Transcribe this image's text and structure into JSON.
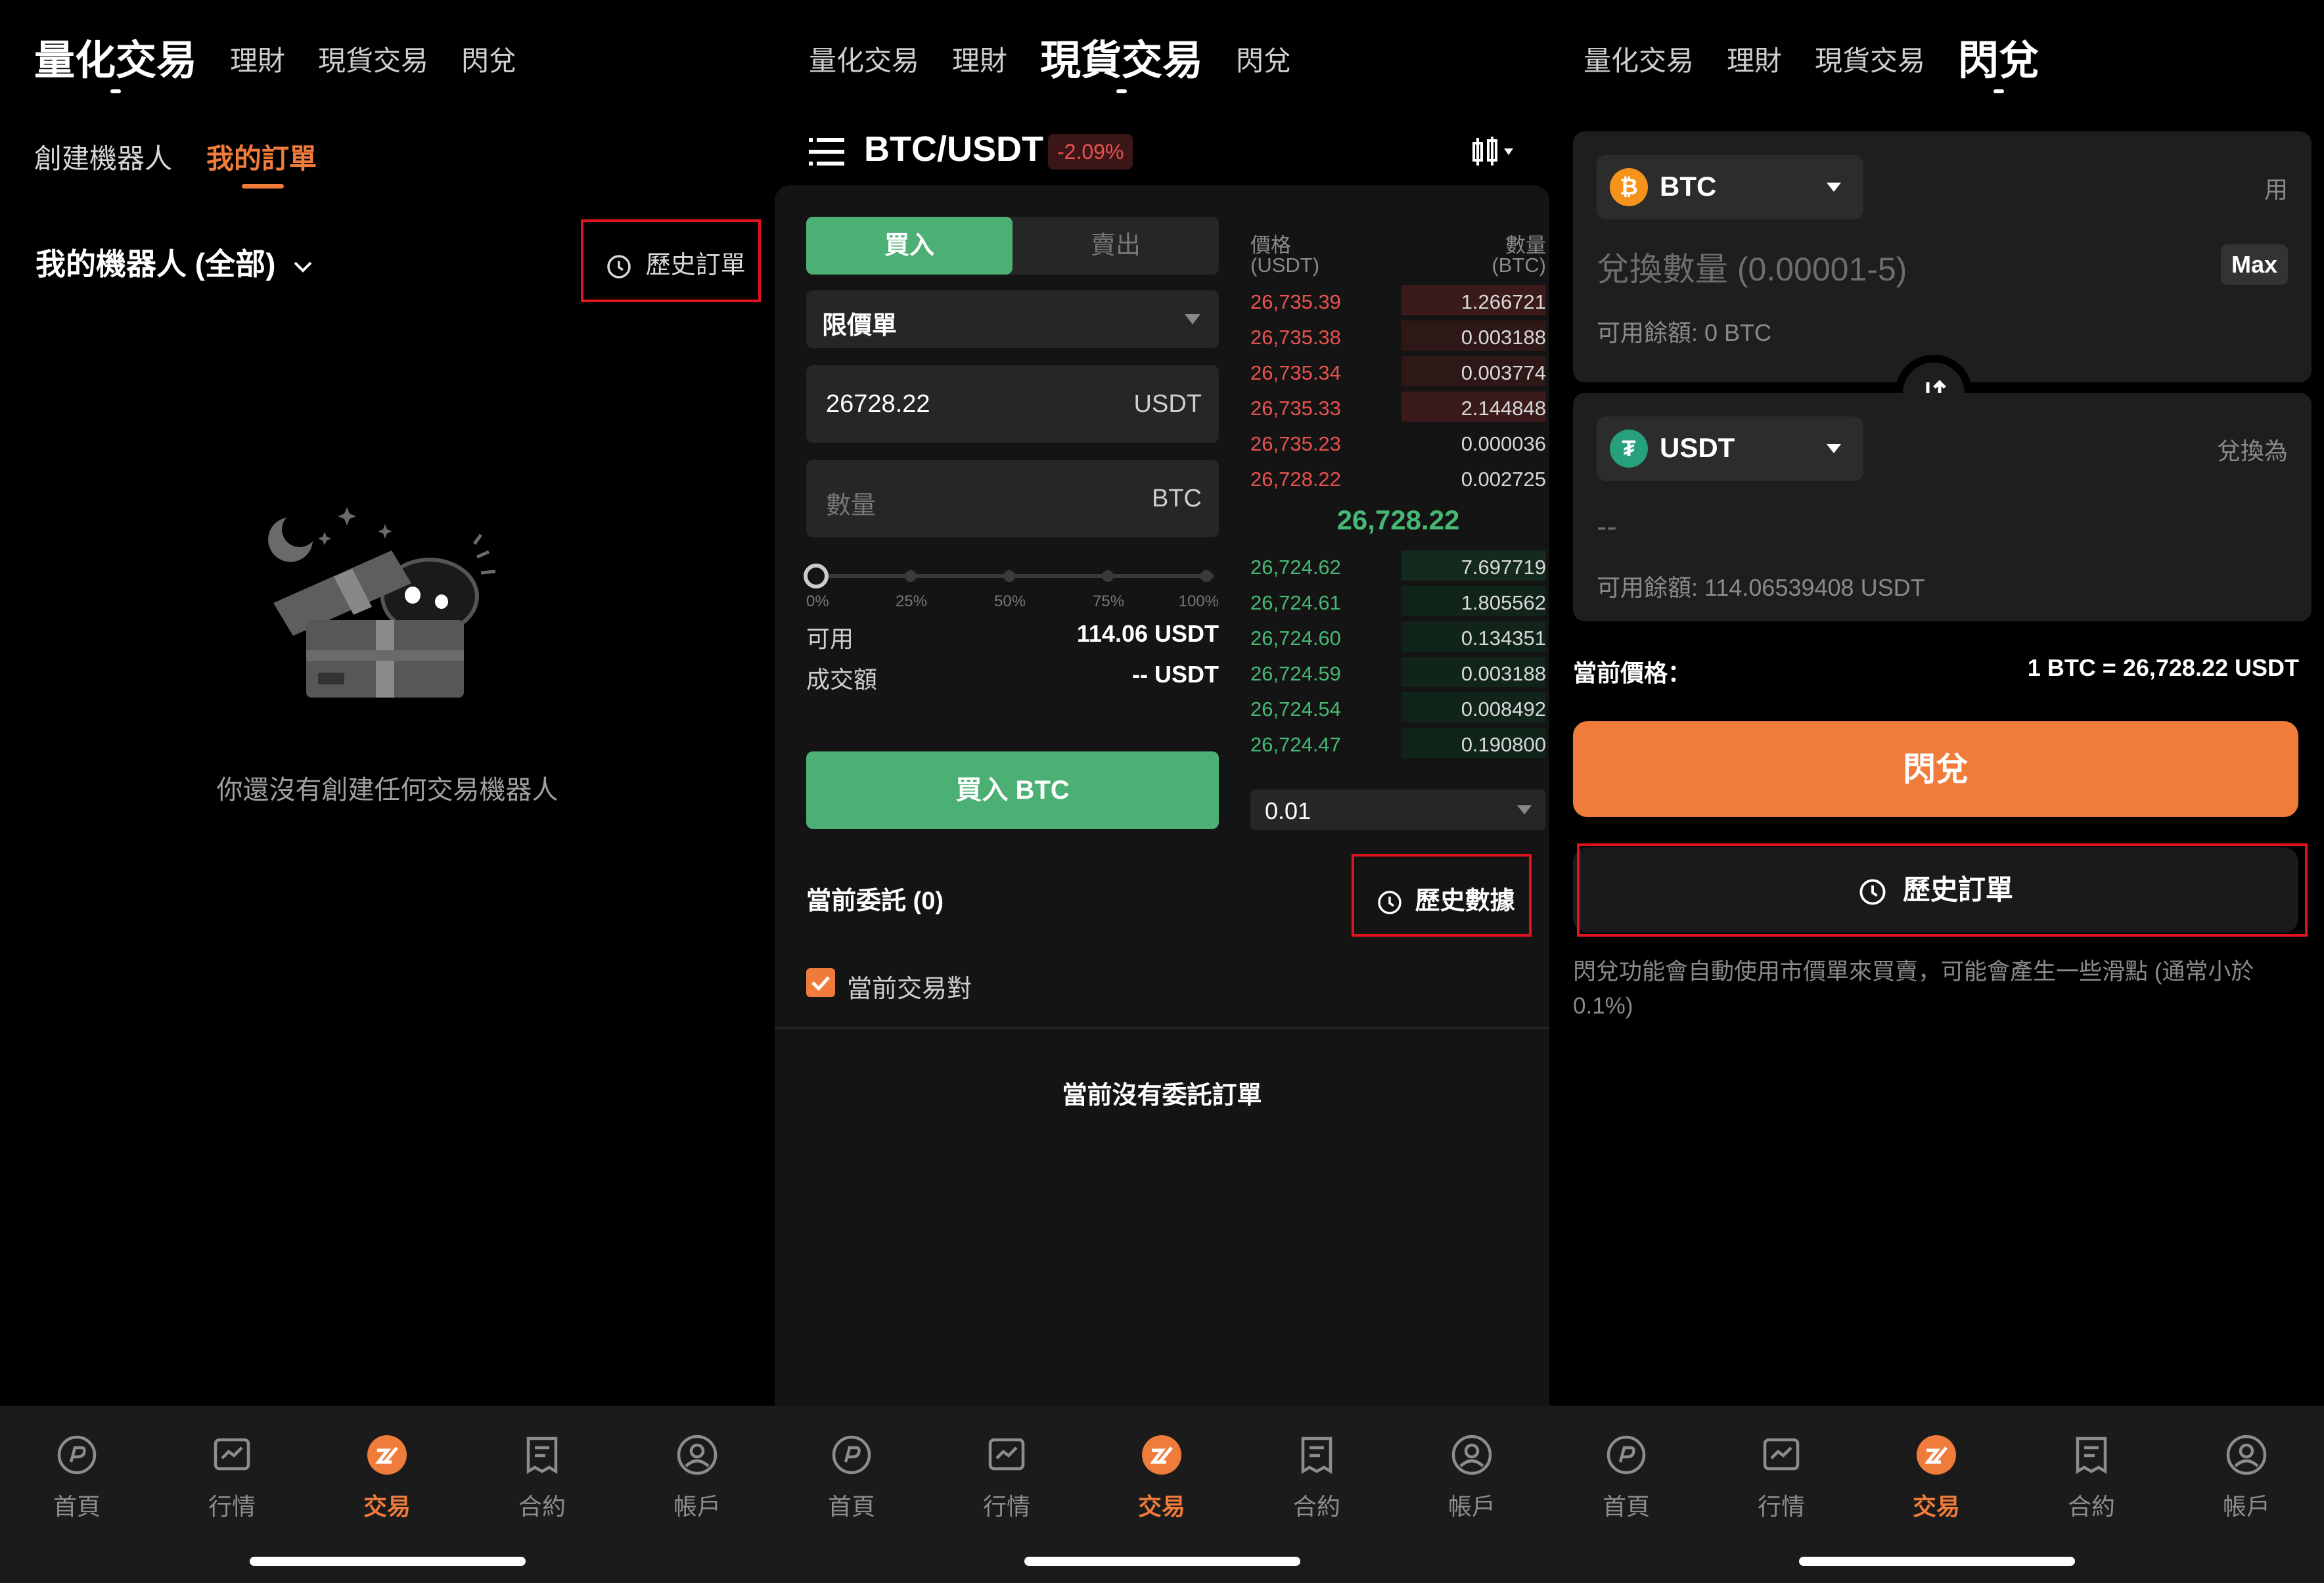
{
  "panel1": {
    "tabs": [
      "量化交易",
      "理財",
      "現貨交易",
      "閃兌"
    ],
    "subtabs": [
      "創建機器人",
      "我的訂單"
    ],
    "robot_selector": "我的機器人 (全部)",
    "history_button": "歷史訂單",
    "empty_text": "你還沒有創建任何交易機器人"
  },
  "panel2": {
    "tabs": [
      "量化交易",
      "理財",
      "現貨交易",
      "閃兌"
    ],
    "pair": "BTC/USDT",
    "change": "-2.09%",
    "buy_tab": "買入",
    "sell_tab": "賣出",
    "order_type": "限價單",
    "price_value": "26728.22",
    "price_unit": "USDT",
    "qty_placeholder": "數量",
    "qty_unit": "BTC",
    "slider_ticks": [
      "0%",
      "25%",
      "50%",
      "75%",
      "100%"
    ],
    "available_label": "可用",
    "available_value": "114.06 USDT",
    "turnover_label": "成交額",
    "turnover_value": "-- USDT",
    "buy_button": "買入 BTC",
    "orderbook": {
      "price_header": "價格",
      "price_unit": "(USDT)",
      "qty_header": "數量",
      "qty_unit": "(BTC)",
      "asks": [
        {
          "price": "26,735.39",
          "qty": "1.266721"
        },
        {
          "price": "26,735.38",
          "qty": "0.003188"
        },
        {
          "price": "26,735.34",
          "qty": "0.003774"
        },
        {
          "price": "26,735.33",
          "qty": "2.144848"
        },
        {
          "price": "26,735.23",
          "qty": "0.000036"
        },
        {
          "price": "26,728.22",
          "qty": "0.002725"
        }
      ],
      "mid_price": "26,728.22",
      "bids": [
        {
          "price": "26,724.62",
          "qty": "7.697719"
        },
        {
          "price": "26,724.61",
          "qty": "1.805562"
        },
        {
          "price": "26,724.60",
          "qty": "0.134351"
        },
        {
          "price": "26,724.59",
          "qty": "0.003188"
        },
        {
          "price": "26,724.54",
          "qty": "0.008492"
        },
        {
          "price": "26,724.47",
          "qty": "0.190800"
        }
      ],
      "precision": "0.01"
    },
    "open_orders": "當前委託 (0)",
    "history_data": "歷史數據",
    "current_pair_check": "當前交易對",
    "no_orders": "當前沒有委託訂單"
  },
  "panel3": {
    "tabs": [
      "量化交易",
      "理財",
      "現貨交易",
      "閃兌"
    ],
    "from_coin": "BTC",
    "from_right": "用",
    "amount_placeholder": "兌換數量 (0.00001-5)",
    "max_label": "Max",
    "from_balance": "可用餘額: 0 BTC",
    "to_coin": "USDT",
    "to_right": "兌換為",
    "to_value": "--",
    "to_balance": "可用餘額: 114.06539408 USDT",
    "price_label": "當前價格：",
    "price_value": "1 BTC = 26,728.22 USDT",
    "swap_button": "閃兌",
    "history_button": "歷史訂單",
    "disclaimer": "閃兌功能會自動使用市價單來買賣，可能會產生一些滑點 (通常小於 0.1%)"
  },
  "nav": [
    "首頁",
    "行情",
    "交易",
    "合約",
    "帳戶"
  ],
  "colors": {
    "accent": "#f07c3b",
    "buy": "#4caf73",
    "sell": "#e8524f",
    "alert": "#e0141e"
  }
}
